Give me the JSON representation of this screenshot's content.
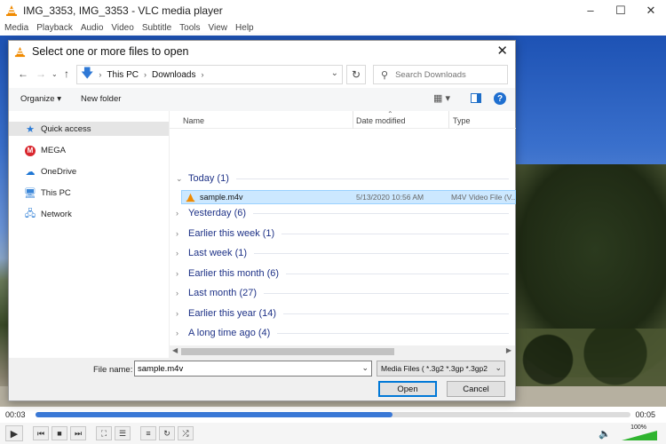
{
  "vlc": {
    "title": "IMG_3353, IMG_3353 - VLC media player",
    "menu": [
      "Media",
      "Playback",
      "Audio",
      "Video",
      "Subtitle",
      "Tools",
      "View",
      "Help"
    ],
    "time_elapsed": "00:03",
    "time_total": "00:05",
    "seek_progress": 0.6,
    "volume": "100%"
  },
  "dialog": {
    "title": "Select one or more files to open",
    "breadcrumb": [
      "This PC",
      "Downloads"
    ],
    "search_placeholder": "Search Downloads",
    "toolbar": {
      "organize": "Organize",
      "new_folder": "New folder"
    },
    "sidebar": [
      "Quick access",
      "MEGA",
      "OneDrive",
      "This PC",
      "Network"
    ],
    "columns": {
      "name": "Name",
      "date": "Date modified",
      "type": "Type"
    },
    "groups": [
      "Today (1)",
      "Yesterday (6)",
      "Earlier this week (1)",
      "Last week (1)",
      "Earlier this month (6)",
      "Last month (27)",
      "Earlier this year (14)",
      "A long time ago (4)"
    ],
    "file": {
      "name": "sample.m4v",
      "date": "5/13/2020 10:56 AM",
      "type": "M4V Video File (V..."
    },
    "filename_label": "File name:",
    "filename_value": "sample.m4v",
    "filter": "Media Files ( *.3g2 *.3gp *.3gp2",
    "open_label": "Open",
    "cancel_label": "Cancel"
  }
}
